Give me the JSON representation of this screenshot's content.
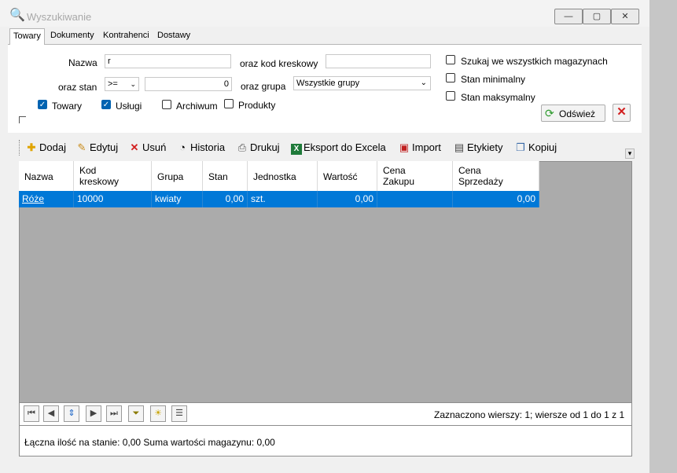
{
  "window": {
    "title": "Wyszukiwanie",
    "min": "—",
    "max": "▢",
    "close": "✕"
  },
  "tabs": [
    "Towary",
    "Dokumenty",
    "Kontrahenci",
    "Dostawy"
  ],
  "filters": {
    "nazwa_label": "Nazwa",
    "nazwa_value": "r",
    "kod_label": "oraz kod kreskowy",
    "kod_value": "",
    "stan_label": "oraz stan",
    "stan_op": ">=",
    "stan_value": "0",
    "grupa_label": "oraz grupa",
    "grupa_value": "Wszystkie grupy",
    "check_towary": "Towary",
    "check_uslugi": "Usługi",
    "check_archiwum": "Archiwum",
    "check_produkty": "Produkty",
    "check_all_warehouses": "Szukaj we wszystkich magazynach",
    "check_stan_min": "Stan minimalny",
    "check_stan_max": "Stan maksymalny",
    "refresh_label": "Odśwież"
  },
  "toolbar": {
    "add": "Dodaj",
    "edit": "Edytuj",
    "delete": "Usuń",
    "history": "Historia",
    "print": "Drukuj",
    "export": "Eksport do Excela",
    "import": "Import",
    "labels": "Etykiety",
    "copy": "Kopiuj"
  },
  "grid": {
    "columns": [
      {
        "l1": "Nazwa",
        "l2": ""
      },
      {
        "l1": "Kod",
        "l2": "kreskowy"
      },
      {
        "l1": "Grupa",
        "l2": ""
      },
      {
        "l1": "Stan",
        "l2": ""
      },
      {
        "l1": "Jednostka",
        "l2": ""
      },
      {
        "l1": "Wartość",
        "l2": ""
      },
      {
        "l1": "Cena",
        "l2": "Zakupu"
      },
      {
        "l1": "Cena",
        "l2": "Sprzedaży"
      }
    ],
    "rows": [
      {
        "nazwa": "Róże",
        "kod": "10000",
        "grupa": "kwiaty",
        "stan": "0,00",
        "jednostka": "szt.",
        "wartosc": "0,00",
        "cena_zakupu": "",
        "cena_sprzedazy": "0,00"
      }
    ]
  },
  "status": {
    "rows": "Zaznaczono wierszy: 1;  wiersze od 1 do 1 z 1",
    "summary": "Łączna ilość na stanie:  0,00    Suma wartości magazynu:  0,00"
  },
  "colors": {
    "selection": "#0078d7",
    "grid_bg": "#ababab",
    "refresh_icon": "#2e9a2e",
    "delete_icon": "#d21f1f"
  },
  "icons": [
    "search-icon",
    "add-icon",
    "edit-icon",
    "delete-icon",
    "history-icon",
    "print-icon",
    "excel-icon",
    "import-icon",
    "labels-icon",
    "copy-icon",
    "refresh-icon",
    "close-red-icon",
    "first-icon",
    "prev-icon",
    "updown-icon",
    "next-icon",
    "last-icon",
    "filter-icon",
    "lightbulb-icon",
    "list-icon"
  ]
}
